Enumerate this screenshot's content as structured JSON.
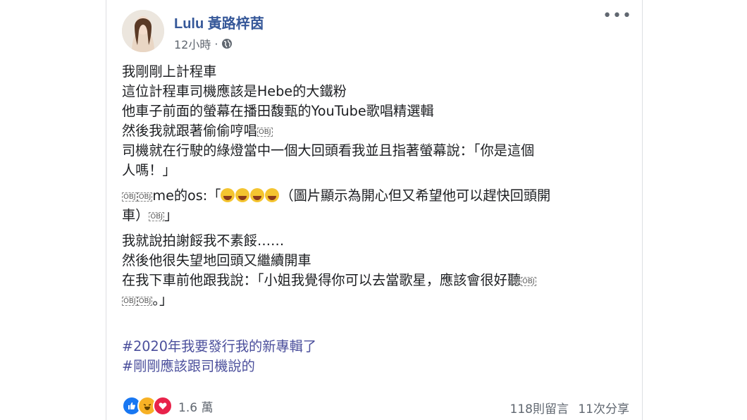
{
  "post": {
    "author": "Lulu 黃路梓茵",
    "time": "12小時",
    "separator": "·",
    "more_label": "•••"
  },
  "content": {
    "l1": "我剛剛上計程車",
    "l2": "這位計程車司機應該是Hebe的大鐵粉",
    "l3": "他車子前面的螢幕在播田馥甄的YouTube歌唱精選輯",
    "l4": "然後我就跟著偷偷哼唱",
    "l5a": "司機就在行駛的綠燈當中一個大回頭看我並且指著螢幕說：「你是這個",
    "l5b": "人嗎！」",
    "l6a_pre": "me的os:「",
    "l6a_post": "（圖片顯示為開心但又希望他可以趕快回頭開",
    "l6b_pre": "車）",
    "l6b_post": "」",
    "l7": "我就說拍謝餒我不素餒……",
    "l8": "然後他很失望地回頭又繼續開車",
    "l9a": "在我下車前他跟我說：「小姐我覺得你可以去當歌星，應該會很好聽",
    "l9b": "。」",
    "obj": "OBJ"
  },
  "hashtags": [
    "#2020年我要發行我的新專輯了",
    "#剛剛應該跟司機說的"
  ],
  "footer": {
    "reaction_count": "1.6 萬",
    "comments": "118則留言",
    "shares": "11次分享"
  },
  "colors": {
    "author": "#365899",
    "hashtag": "#4b4f9c",
    "like": "#1877f2",
    "love": "#e8234a",
    "haha": "#f7b125"
  },
  "icons": [
    "globe-icon",
    "more-options-icon",
    "like-reaction-icon",
    "haha-reaction-icon",
    "love-reaction-icon",
    "crying-laughing-cat-emoji"
  ]
}
